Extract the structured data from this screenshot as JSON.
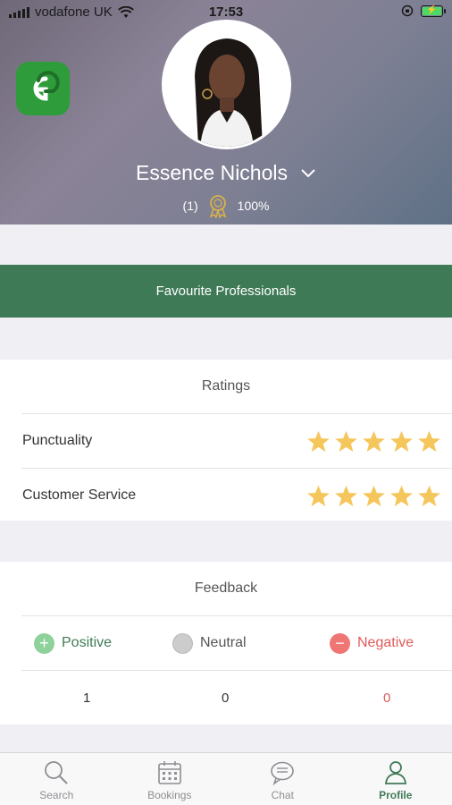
{
  "status_bar": {
    "carrier": "vodafone UK",
    "time": "17:53"
  },
  "profile": {
    "name": "Essence Nichols",
    "review_count": "(1)",
    "score": "100%"
  },
  "favourite_button": "Favourite Professionals",
  "ratings": {
    "title": "Ratings",
    "items": [
      {
        "label": "Punctuality",
        "stars": 5
      },
      {
        "label": "Customer Service",
        "stars": 5
      }
    ]
  },
  "feedback": {
    "title": "Feedback",
    "positive_label": "Positive",
    "neutral_label": "Neutral",
    "negative_label": "Negative",
    "positive_count": "1",
    "neutral_count": "0",
    "negative_count": "0"
  },
  "tabs": [
    {
      "label": "Search",
      "icon": "search-icon"
    },
    {
      "label": "Bookings",
      "icon": "calendar-icon"
    },
    {
      "label": "Chat",
      "icon": "chat-icon"
    },
    {
      "label": "Profile",
      "icon": "profile-icon",
      "active": true
    }
  ],
  "colors": {
    "primary_green": "#3f7a57",
    "star_gold": "#f5c65b",
    "positive_green": "#8fd19a",
    "negative_red": "#f07575",
    "neutral_gray": "#cccccc"
  }
}
